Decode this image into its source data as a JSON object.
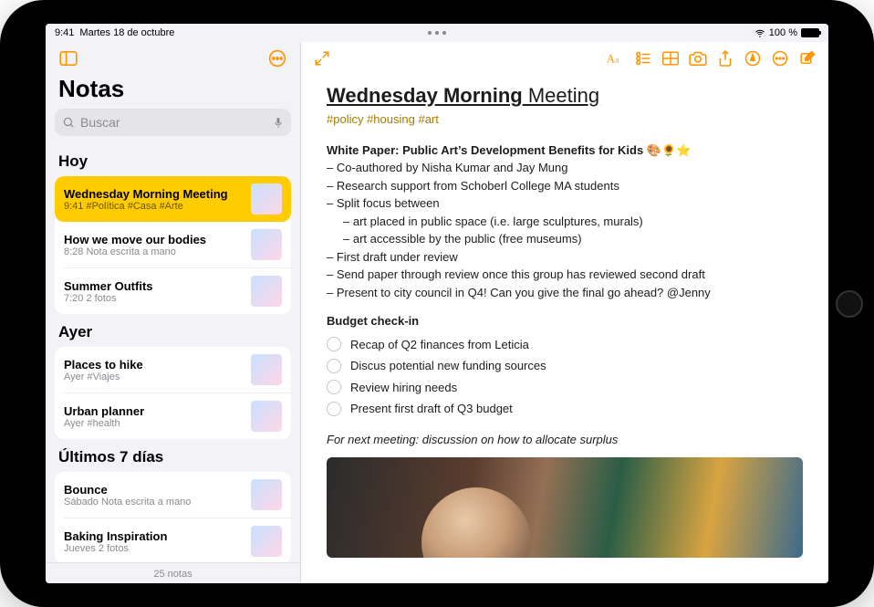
{
  "status": {
    "time": "9:41",
    "date": "Martes 18 de octubre",
    "battery_text": "100 %"
  },
  "sidebar": {
    "title": "Notas",
    "search_placeholder": "Buscar",
    "footer": "25 notas",
    "sections": [
      {
        "header": "Hoy",
        "items": [
          {
            "title": "Wednesday Morning Meeting",
            "time": "9:41",
            "sub": "#Política #Casa #Arte",
            "selected": true
          },
          {
            "title": "How we move our bodies",
            "time": "8:28",
            "sub": "Nota escrita a mano"
          },
          {
            "title": "Summer Outfits",
            "time": "7:20",
            "sub": "2 fotos"
          }
        ]
      },
      {
        "header": "Ayer",
        "items": [
          {
            "title": "Places to hike",
            "time": "Ayer",
            "sub": "#Viajes"
          },
          {
            "title": "Urban planner",
            "time": "Ayer",
            "sub": "#health"
          }
        ]
      },
      {
        "header": "Últimos 7 días",
        "items": [
          {
            "title": "Bounce",
            "time": "Sábado",
            "sub": "Nota escrita a mano"
          },
          {
            "title": "Baking Inspiration",
            "time": "Jueves",
            "sub": "2 fotos"
          }
        ]
      }
    ]
  },
  "note": {
    "heading_bold": "Wednesday Morning",
    "heading_rest": " Meeting",
    "tags": "#policy #housing #art",
    "paper_title": "White Paper: Public Art’s Development Benefits for Kids 🎨🌻⭐",
    "lines": [
      "– Co-authored by Nisha Kumar and Jay Mung",
      "– Research support from Schoberl College MA students",
      "– Split focus between"
    ],
    "indent_lines": [
      "– art placed in public space (i.e. large sculptures, murals)",
      "– art accessible by the public (free museums)"
    ],
    "lines2": [
      "– First draft under review",
      "– Send paper through review once this group has reviewed second draft",
      "– Present to city council in Q4! Can you give the final go ahead? @Jenny"
    ],
    "budget_title": "Budget check-in",
    "checks": [
      "Recap of Q2 finances from Leticia",
      "Discus potential new funding sources",
      "Review hiring needs",
      "Present first draft of Q3 budget"
    ],
    "italic": "For next meeting: discussion on how to allocate surplus"
  }
}
